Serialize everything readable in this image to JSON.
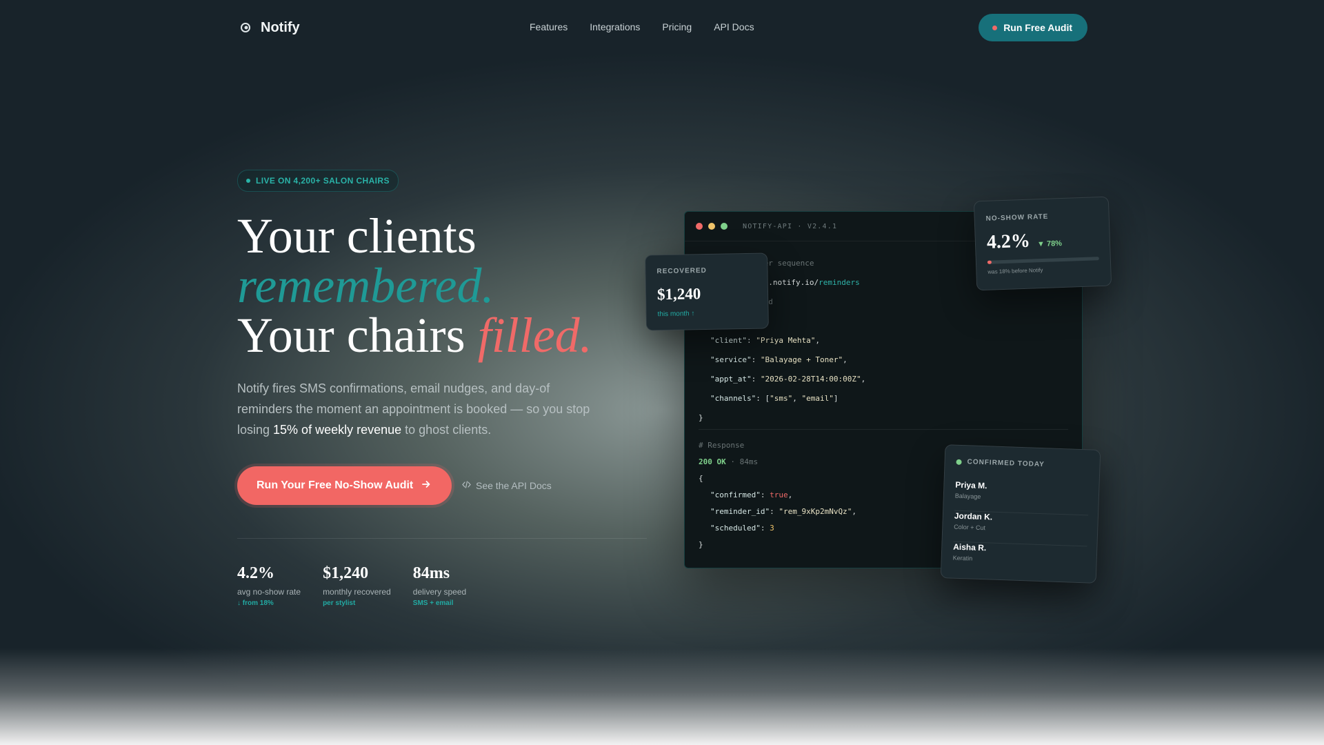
{
  "nav": {
    "brand": "Notify",
    "links": [
      "Features",
      "Integrations",
      "Pricing",
      "API Docs"
    ],
    "cta": "Run Free Audit"
  },
  "hero": {
    "badge": "LIVE ON 4,200+ SALON CHAIRS",
    "headline_line1": "Your clients",
    "headline_line2": "remembered.",
    "headline_line3a": "Your chairs ",
    "headline_line3b": "filled.",
    "sub_part1": "Notify fires SMS confirmations, email nudges, and day-of reminders the moment an appointment is booked — so you stop losing ",
    "sub_highlight": "15% of weekly revenue",
    "sub_part2": " to ghost clients.",
    "cta_primary": "Run Your Free No-Show Audit",
    "cta_secondary": "See the API Docs"
  },
  "stats": [
    {
      "value": "4.2%",
      "label": "avg no-show rate",
      "sub": "↓ from 18%"
    },
    {
      "value": "$1,240",
      "label": "monthly recovered",
      "sub": "per stylist"
    },
    {
      "value": "84ms",
      "label": "delivery speed",
      "sub": "SMS + email"
    }
  ],
  "terminal": {
    "title": "NOTIFY-API · V2.4.1",
    "comment_request": "der sequence",
    "url_prefix": "pi.notify.io/",
    "url_path": "reminders",
    "comment_payload": "oad",
    "client": "Priya Mehta",
    "service": "Balayage + Toner",
    "appt_at": "2026-02-28T14:00:00Z",
    "channel_1": "sms",
    "channel_2": "email",
    "comment_response": "# Response",
    "status": "200 OK",
    "latency": " · 84ms",
    "confirmed": "true",
    "reminder_id": "rem_9xKp2mNvQz",
    "scheduled": "3"
  },
  "recovered_card": {
    "label": "RECOVERED",
    "value": "$1,240",
    "sub": "this month ↑"
  },
  "noshow_card": {
    "label": "NO-SHOW RATE",
    "value": "4.2%",
    "delta": "▼ 78%",
    "note": "was 18% before Notify",
    "fill": 0.04
  },
  "confirmed_card": {
    "label": "CONFIRMED TODAY",
    "items": [
      {
        "name": "Priya M.",
        "service": "Balayage"
      },
      {
        "name": "Jordan K.",
        "service": "Color + Cut"
      },
      {
        "name": "Aisha R.",
        "service": "Keratin"
      }
    ]
  },
  "colors": {
    "teal": "#17707a",
    "coral": "#f06a68",
    "accent_teal": "#1f9a96"
  }
}
